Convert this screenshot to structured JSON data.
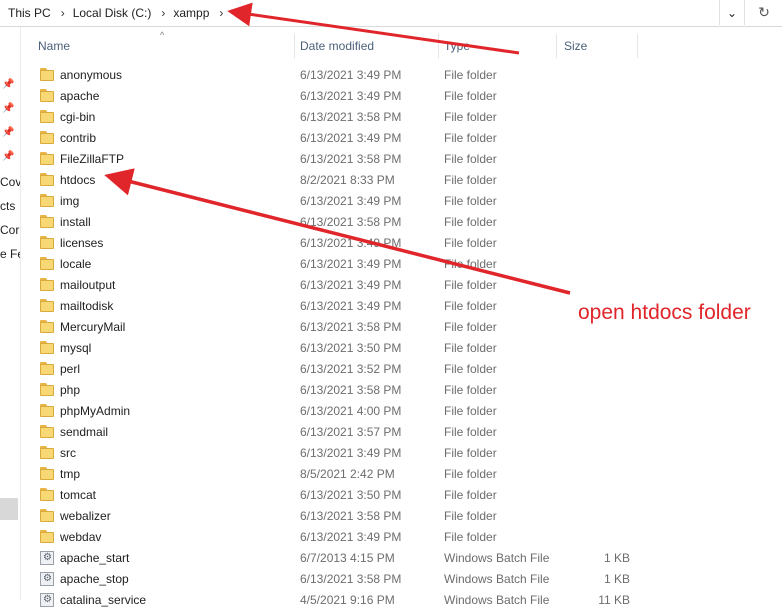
{
  "address_bar": {
    "crumbs": [
      "This PC",
      "Local Disk (C:)",
      "xampp"
    ],
    "separator": "›",
    "dropdown_glyph": "⌄",
    "refresh_glyph": "↻"
  },
  "nav_pane": {
    "pin_glyph": "📌",
    "items": [
      "Cov",
      "cts",
      "Cor",
      "e Fe"
    ]
  },
  "columns": {
    "name": "Name",
    "date_modified": "Date modified",
    "type": "Type",
    "size": "Size",
    "sort_indicator": "^"
  },
  "files": [
    {
      "name": "anonymous",
      "date": "6/13/2021 3:49 PM",
      "type": "File folder",
      "size": "",
      "icon": "folder-icon"
    },
    {
      "name": "apache",
      "date": "6/13/2021 3:49 PM",
      "type": "File folder",
      "size": "",
      "icon": "folder-icon"
    },
    {
      "name": "cgi-bin",
      "date": "6/13/2021 3:58 PM",
      "type": "File folder",
      "size": "",
      "icon": "folder-icon"
    },
    {
      "name": "contrib",
      "date": "6/13/2021 3:49 PM",
      "type": "File folder",
      "size": "",
      "icon": "folder-icon"
    },
    {
      "name": "FileZillaFTP",
      "date": "6/13/2021 3:58 PM",
      "type": "File folder",
      "size": "",
      "icon": "folder-icon"
    },
    {
      "name": "htdocs",
      "date": "8/2/2021 8:33 PM",
      "type": "File folder",
      "size": "",
      "icon": "folder-icon"
    },
    {
      "name": "img",
      "date": "6/13/2021 3:49 PM",
      "type": "File folder",
      "size": "",
      "icon": "folder-icon"
    },
    {
      "name": "install",
      "date": "6/13/2021 3:58 PM",
      "type": "File folder",
      "size": "",
      "icon": "folder-icon"
    },
    {
      "name": "licenses",
      "date": "6/13/2021 3:49 PM",
      "type": "File folder",
      "size": "",
      "icon": "folder-icon"
    },
    {
      "name": "locale",
      "date": "6/13/2021 3:49 PM",
      "type": "File folder",
      "size": "",
      "icon": "folder-icon"
    },
    {
      "name": "mailoutput",
      "date": "6/13/2021 3:49 PM",
      "type": "File folder",
      "size": "",
      "icon": "folder-icon"
    },
    {
      "name": "mailtodisk",
      "date": "6/13/2021 3:49 PM",
      "type": "File folder",
      "size": "",
      "icon": "folder-icon"
    },
    {
      "name": "MercuryMail",
      "date": "6/13/2021 3:58 PM",
      "type": "File folder",
      "size": "",
      "icon": "folder-icon"
    },
    {
      "name": "mysql",
      "date": "6/13/2021 3:50 PM",
      "type": "File folder",
      "size": "",
      "icon": "folder-icon"
    },
    {
      "name": "perl",
      "date": "6/13/2021 3:52 PM",
      "type": "File folder",
      "size": "",
      "icon": "folder-icon"
    },
    {
      "name": "php",
      "date": "6/13/2021 3:58 PM",
      "type": "File folder",
      "size": "",
      "icon": "folder-icon"
    },
    {
      "name": "phpMyAdmin",
      "date": "6/13/2021 4:00 PM",
      "type": "File folder",
      "size": "",
      "icon": "folder-icon"
    },
    {
      "name": "sendmail",
      "date": "6/13/2021 3:57 PM",
      "type": "File folder",
      "size": "",
      "icon": "folder-icon"
    },
    {
      "name": "src",
      "date": "6/13/2021 3:49 PM",
      "type": "File folder",
      "size": "",
      "icon": "folder-icon"
    },
    {
      "name": "tmp",
      "date": "8/5/2021 2:42 PM",
      "type": "File folder",
      "size": "",
      "icon": "folder-icon"
    },
    {
      "name": "tomcat",
      "date": "6/13/2021 3:50 PM",
      "type": "File folder",
      "size": "",
      "icon": "folder-icon"
    },
    {
      "name": "webalizer",
      "date": "6/13/2021 3:58 PM",
      "type": "File folder",
      "size": "",
      "icon": "folder-icon"
    },
    {
      "name": "webdav",
      "date": "6/13/2021 3:49 PM",
      "type": "File folder",
      "size": "",
      "icon": "folder-icon"
    },
    {
      "name": "apache_start",
      "date": "6/7/2013 4:15 PM",
      "type": "Windows Batch File",
      "size": "1 KB",
      "icon": "batch-file-icon"
    },
    {
      "name": "apache_stop",
      "date": "6/13/2021 3:58 PM",
      "type": "Windows Batch File",
      "size": "1 KB",
      "icon": "batch-file-icon"
    },
    {
      "name": "catalina_service",
      "date": "4/5/2021 9:16 PM",
      "type": "Windows Batch File",
      "size": "11 KB",
      "icon": "batch-file-icon"
    }
  ],
  "annotation": {
    "text": "open htdocs folder",
    "color": "#e0262b"
  }
}
